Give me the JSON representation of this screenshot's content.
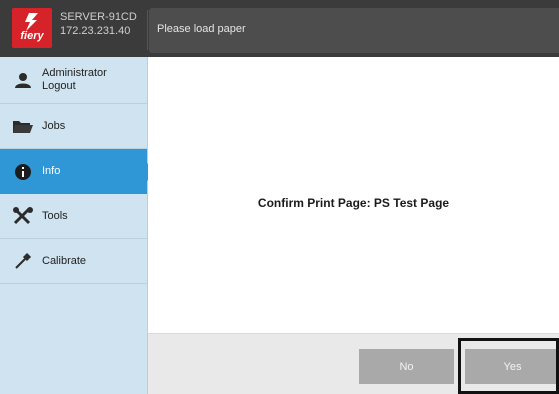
{
  "header": {
    "logo_text": "fiery",
    "server_name": "SERVER-91CD",
    "server_ip": "172.23.231.40",
    "status_message": "Please load paper",
    "logo_color": "#d6232a"
  },
  "sidebar": {
    "items": [
      {
        "label": "Administrator Logout",
        "icon": "user-icon",
        "active": false
      },
      {
        "label": "Jobs",
        "icon": "folder-icon",
        "active": false
      },
      {
        "label": "Info",
        "icon": "info-icon",
        "active": true
      },
      {
        "label": "Tools",
        "icon": "tools-icon",
        "active": false
      },
      {
        "label": "Calibrate",
        "icon": "pipette-icon",
        "active": false
      }
    ],
    "active_color": "#2f97d6"
  },
  "main": {
    "confirm_text": "Confirm Print Page:  PS Test Page"
  },
  "dialog": {
    "no_label": "No",
    "yes_label": "Yes"
  }
}
